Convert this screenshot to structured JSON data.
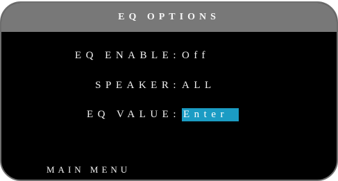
{
  "header": {
    "title": "EQ OPTIONS"
  },
  "menu": {
    "items": [
      {
        "label": "EQ ENABLE",
        "separator": ":",
        "value": "Off"
      },
      {
        "label": "SPEAKER",
        "separator": ":",
        "value": "ALL"
      },
      {
        "label": "EQ VALUE",
        "separator": ":",
        "value": "Enter"
      }
    ]
  },
  "footer": {
    "label": "MAIN MENU"
  },
  "colors": {
    "header_bg": "#787878",
    "screen_bg": "#000000",
    "highlight_bg": "#1b9cc4",
    "text": "#f2f2f2"
  }
}
